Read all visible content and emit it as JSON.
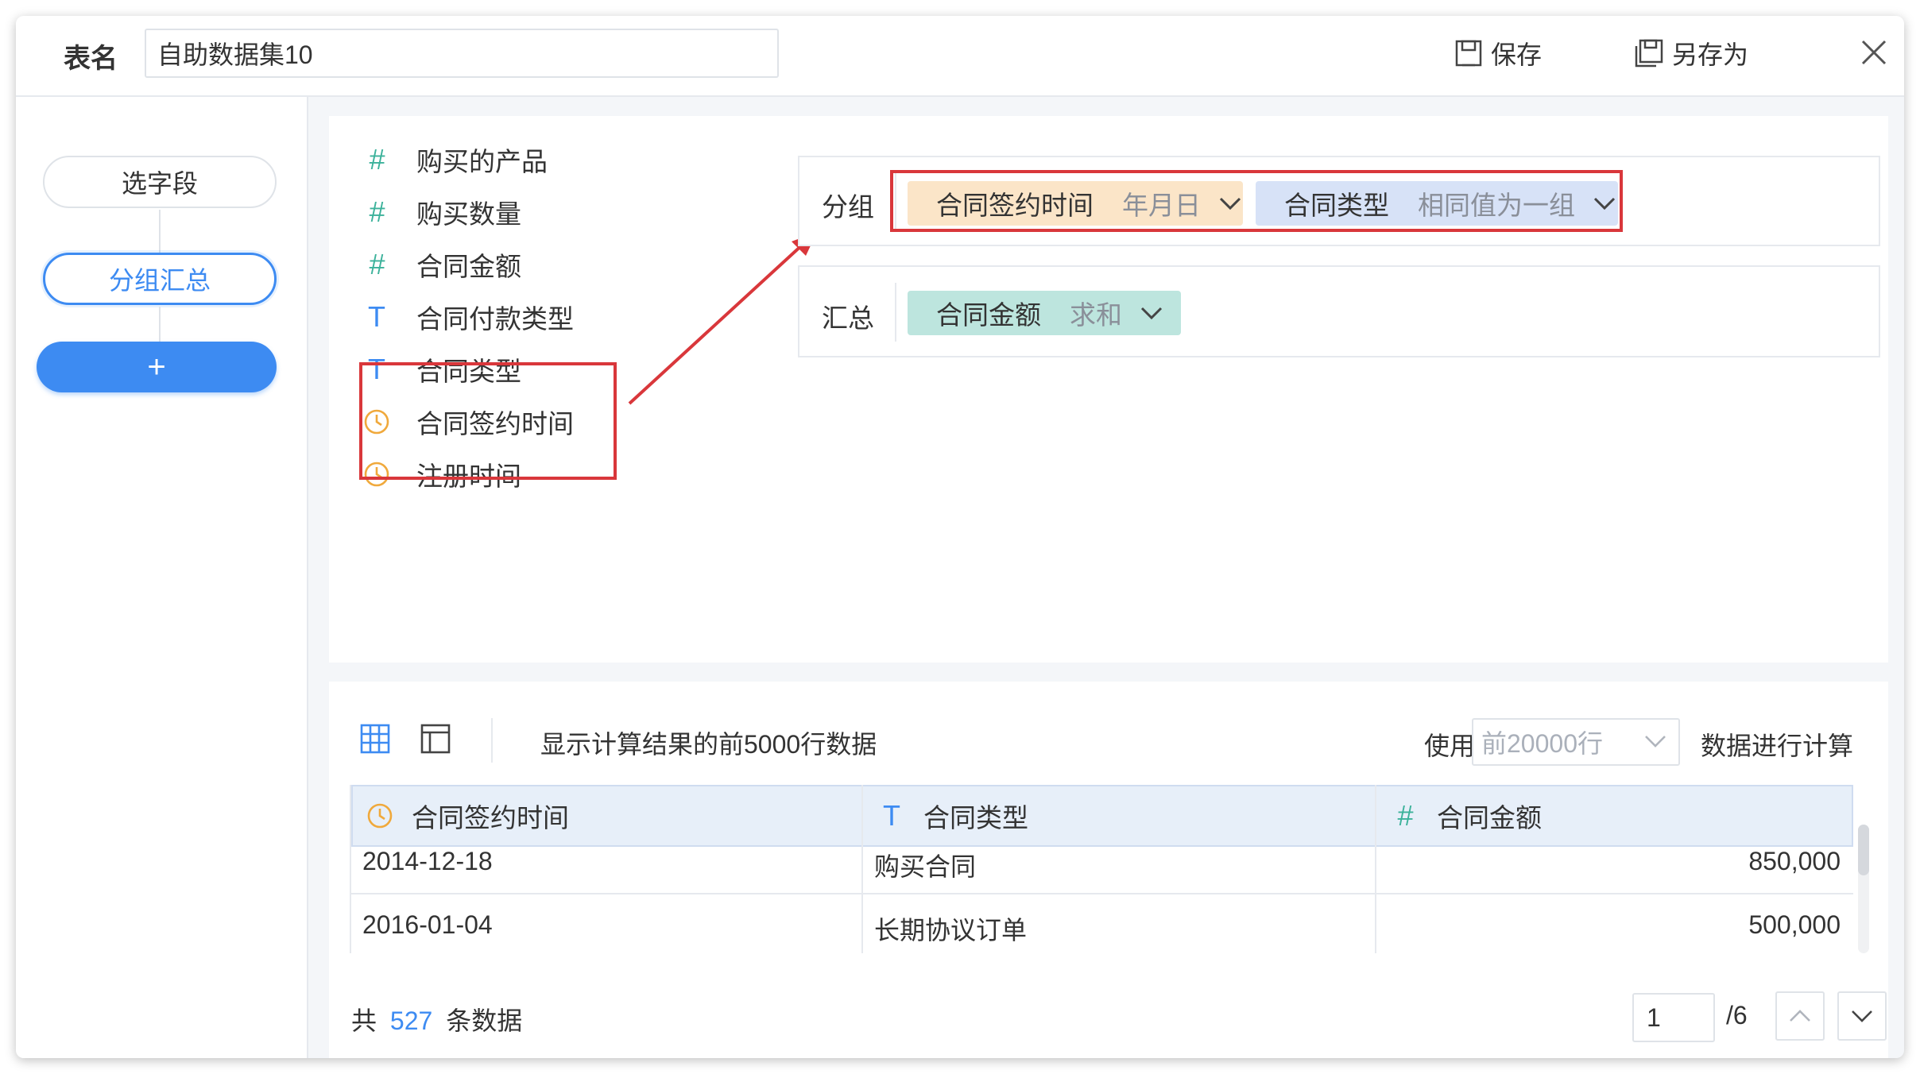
{
  "header": {
    "table_name_label": "表名",
    "table_name_value": "自助数据集10",
    "save_label": "保存",
    "save_as_label": "另存为"
  },
  "sidebar": {
    "steps": [
      {
        "label": "选字段"
      },
      {
        "label": "分组汇总"
      }
    ],
    "add_label": "+"
  },
  "fields": [
    {
      "icon": "number-icon",
      "name": "购买的产品"
    },
    {
      "icon": "number-icon",
      "name": "购买数量"
    },
    {
      "icon": "number-icon",
      "name": "合同金额"
    },
    {
      "icon": "text-icon",
      "name": "合同付款类型"
    },
    {
      "icon": "text-icon",
      "name": "合同类型"
    },
    {
      "icon": "date-icon",
      "name": "合同签约时间"
    },
    {
      "icon": "date-icon",
      "name": "注册时间"
    }
  ],
  "group": {
    "label": "分组",
    "tags": [
      {
        "name": "合同签约时间",
        "option": "年月日",
        "color": "#fbe5c8"
      },
      {
        "name": "合同类型",
        "option": "相同值为一组",
        "color": "#d7e2f7"
      }
    ]
  },
  "summary": {
    "label": "汇总",
    "tags": [
      {
        "name": "合同金额",
        "option": "求和",
        "color": "#bde5de"
      }
    ]
  },
  "preview": {
    "info_text": "显示计算结果的前5000行数据",
    "use_label": "使用",
    "row_select": "前20000行",
    "calc_label": "数据进行计算",
    "columns": [
      {
        "icon": "date-icon",
        "name": "合同签约时间"
      },
      {
        "icon": "text-icon",
        "name": "合同类型"
      },
      {
        "icon": "number-icon",
        "name": "合同金额"
      }
    ],
    "rows": [
      [
        "2014-12-18",
        "购买合同",
        "850,000"
      ],
      [
        "2016-01-04",
        "长期协议订单",
        "500,000"
      ]
    ],
    "total_prefix": "共",
    "total_count": "527",
    "total_suffix": "条数据",
    "page_current": "1",
    "page_total": "/6"
  },
  "colors": {
    "accent": "#3d8bf2",
    "highlight_red": "#d9373b",
    "number_icon": "#3cb29b",
    "date_icon": "#f0a93c"
  }
}
